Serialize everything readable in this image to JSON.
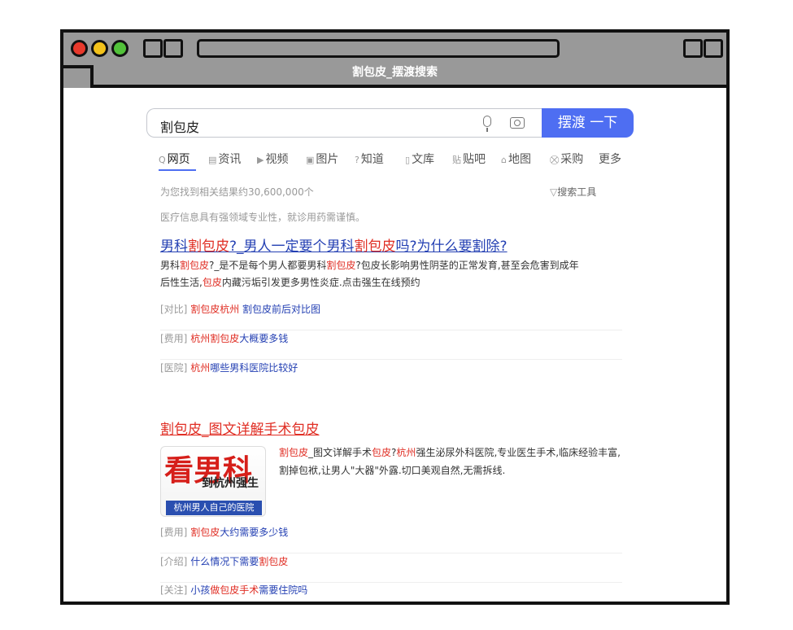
{
  "window": {
    "title": "割包皮_摆渡搜索"
  },
  "search": {
    "query": "割包皮",
    "button_label": "摆渡 一下"
  },
  "tabs": [
    {
      "icon": "search-icon",
      "glyph": "Q",
      "label": "网页"
    },
    {
      "icon": "news-icon",
      "glyph": "▤",
      "label": "资讯"
    },
    {
      "icon": "video-icon",
      "glyph": "▶",
      "label": "视频"
    },
    {
      "icon": "image-icon",
      "glyph": "▣",
      "label": "图片"
    },
    {
      "icon": "question-icon",
      "glyph": "?",
      "label": "知道"
    },
    {
      "icon": "doc-icon",
      "glyph": "▯",
      "label": "文库"
    },
    {
      "icon": "tieba-icon",
      "glyph": "贴",
      "label": "贴吧"
    },
    {
      "icon": "map-icon",
      "glyph": "⌂",
      "label": "地图"
    },
    {
      "icon": "shop-icon",
      "glyph": "⛒",
      "label": "采购"
    },
    {
      "icon": "",
      "glyph": "",
      "label": "更多"
    }
  ],
  "results_count": "为您找到相关结果约30,600,000个",
  "search_tools": "搜索工具",
  "notice": "医疗信息具有强领域专业性，就诊用药需谨慎。",
  "result1": {
    "title": [
      "男科",
      "割包皮",
      "?_男人一定要个男科",
      "割包皮",
      "吗?为什么要割除?"
    ],
    "desc_line1": [
      "男科",
      "割包皮",
      "?_是不是每个男人都要男科",
      "割包皮",
      "?包皮长影响男性阴茎的正常发育,甚至会危害到成年"
    ],
    "desc_line2": [
      "后性生活,",
      "包皮",
      "内藏污垢引发更多男性炎症.点击强生在线预约"
    ],
    "sublinks": [
      {
        "tag": "[对比]",
        "red": "割包皮杭州",
        "blue": " 割包皮前后对比图"
      },
      {
        "tag": "[费用]",
        "red": "杭州割包皮",
        "blue": "大概要多钱"
      },
      {
        "tag": "[医院]",
        "red": "杭州",
        "blue": "哪些男科医院比较好"
      }
    ]
  },
  "result2": {
    "title": [
      "割包皮",
      "_图文详解手术包皮"
    ],
    "thumb": {
      "big": "看男科",
      "mid": "到杭州强生",
      "bar": "杭州男人自己的医院"
    },
    "desc": [
      "割包皮",
      "_图文详解手术",
      "包皮",
      "?",
      "杭州",
      "强生泌尿外科医院,专业医生手术,临床经验丰富,割掉包袱,让男人\"大器\"外露.切口美观自然,无需拆线."
    ],
    "sublinks": [
      {
        "tag": "[费用]",
        "red": "割包皮",
        "blue": "大约需要多少钱"
      },
      {
        "tag": "[介绍]",
        "blue": " 什么情况下需要",
        "red": "割包皮"
      },
      {
        "tag": "[关注]",
        "blue": " 小孩",
        "red": "做包皮手术",
        "blue2": "需要住院吗"
      }
    ]
  }
}
